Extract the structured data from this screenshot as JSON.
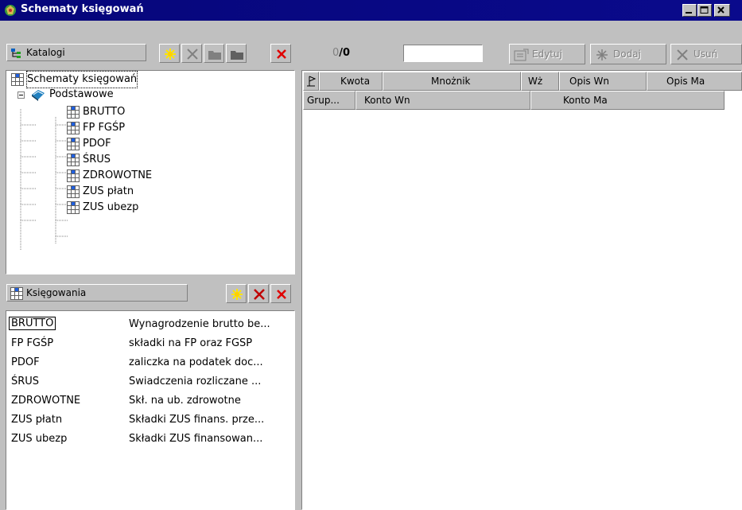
{
  "window": {
    "title": "Schematy księgowań"
  },
  "catalogs": {
    "label": "Katalogi",
    "icon": "tree-icon",
    "toolbar": [
      "new-icon",
      "delete-x-icon",
      "folder-icon",
      "folder-dark-icon",
      "close-red-icon"
    ]
  },
  "tree": {
    "root": "Schematy księgowań",
    "group": "Podstawowe",
    "items": [
      "BRUTTO",
      "FP FGŚP",
      "PDOF",
      "ŚRUS",
      "ZDROWOTNE",
      "ZUS płatn",
      "ZUS ubezp"
    ]
  },
  "postings": {
    "label": "Księgowania",
    "rows": [
      {
        "code": "BRUTTO",
        "desc": "Wynagrodzenie brutto be..."
      },
      {
        "code": "FP FGŚP",
        "desc": "składki na FP oraz FGŚP"
      },
      {
        "code": "PDOF",
        "desc": "zaliczka na podatek doc..."
      },
      {
        "code": "ŚRUS",
        "desc": "Świadczenia rozliczane ..."
      },
      {
        "code": "ZDROWOTNE",
        "desc": "Skł. na ub. zdrowotne"
      },
      {
        "code": "ZUS płatn",
        "desc": "Składki ZUS finans. prze..."
      },
      {
        "code": "ZUS ubezp",
        "desc": "Składki ZUS finansowan..."
      }
    ]
  },
  "right": {
    "counter_left": "0",
    "counter_sep": "/",
    "counter_right": "0",
    "search_value": "",
    "edit_label": "Edytuj",
    "add_label": "Dodaj",
    "delete_label": "Usuń",
    "columns_row1": [
      "Kwota",
      "Mnożnik",
      "Wż",
      "Opis Wn",
      "Opis Ma"
    ],
    "columns_row2": [
      "Grup...",
      "Konto Wn",
      "Konto Ma"
    ]
  },
  "colors": {
    "title_bar": "#0a0a8c",
    "face": "#c0c0c0",
    "accent_yellow": "#ffe600",
    "accent_red": "#e00000"
  }
}
